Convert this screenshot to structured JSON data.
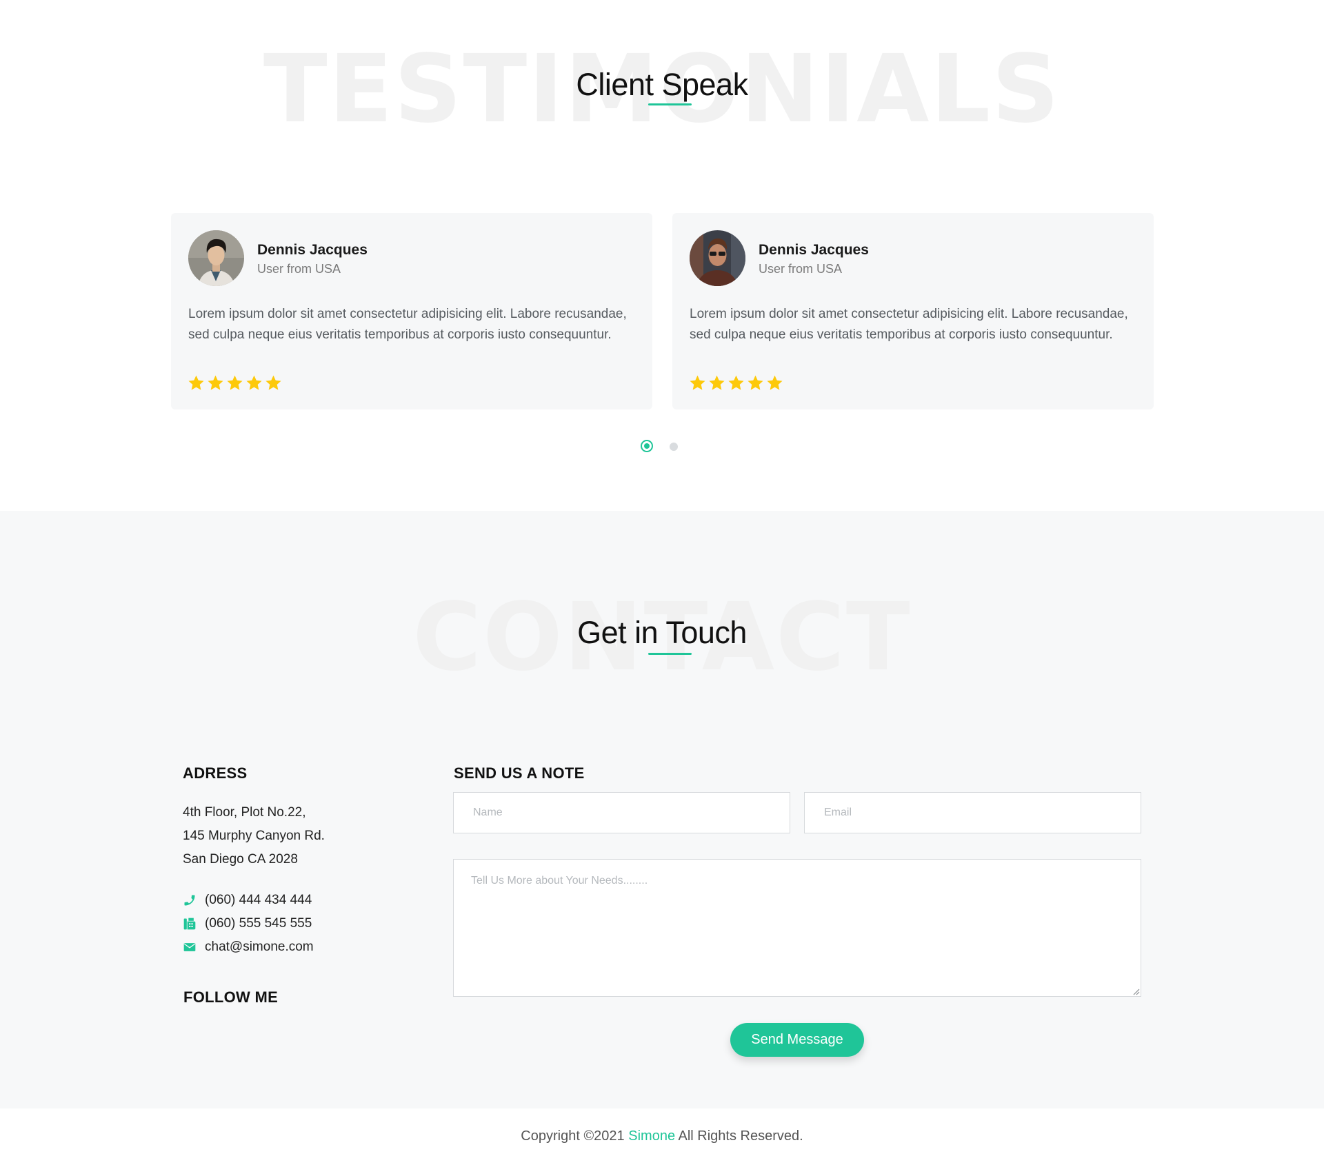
{
  "testimonials": {
    "background_word": "TESTIMONIALS",
    "title": "Client Speak",
    "cards": [
      {
        "name": "Dennis Jacques",
        "role": "User from USA",
        "text": "Lorem ipsum dolor sit amet consectetur adipisicing elit. Labore recusandae, sed culpa neque eius veritatis temporibus at corporis iusto consequuntur.",
        "rating": 5,
        "avatar": "person-photo-young"
      },
      {
        "name": "Dennis Jacques",
        "role": "User from USA",
        "text": "Lorem ipsum dolor sit amet consectetur adipisicing elit. Labore recusandae, sed culpa neque eius veritatis temporibus at corporis iusto consequuntur.",
        "rating": 5,
        "avatar": "person-photo-bearded"
      }
    ],
    "pagination": {
      "pages": 2,
      "active": 1
    }
  },
  "contact": {
    "background_word": "CONTACT",
    "title": "Get in Touch",
    "address": {
      "heading": "ADRESS",
      "lines": [
        "4th Floor, Plot No.22,",
        "145 Murphy Canyon Rd.",
        "San Diego CA 2028"
      ],
      "phone": "(060) 444 434 444",
      "fax": "(060) 555 545 555",
      "email": "chat@simone.com"
    },
    "follow_heading": "FOLLOW ME",
    "form": {
      "heading": "SEND US A NOTE",
      "name_placeholder": "Name",
      "email_placeholder": "Email",
      "message_placeholder": "Tell Us More about Your Needs........",
      "submit_label": "Send Message"
    }
  },
  "footer": {
    "prefix": "Copyright ©2021",
    "brand": "Simone",
    "suffix": "All Rights Reserved."
  },
  "colors": {
    "accent": "#1fc598",
    "star": "#fdc90a",
    "contact_background": "#f7f8f9",
    "card_background": "#f6f7f8"
  },
  "icons": [
    "phone-icon",
    "fax-icon",
    "envelope-icon",
    "star-icon"
  ]
}
